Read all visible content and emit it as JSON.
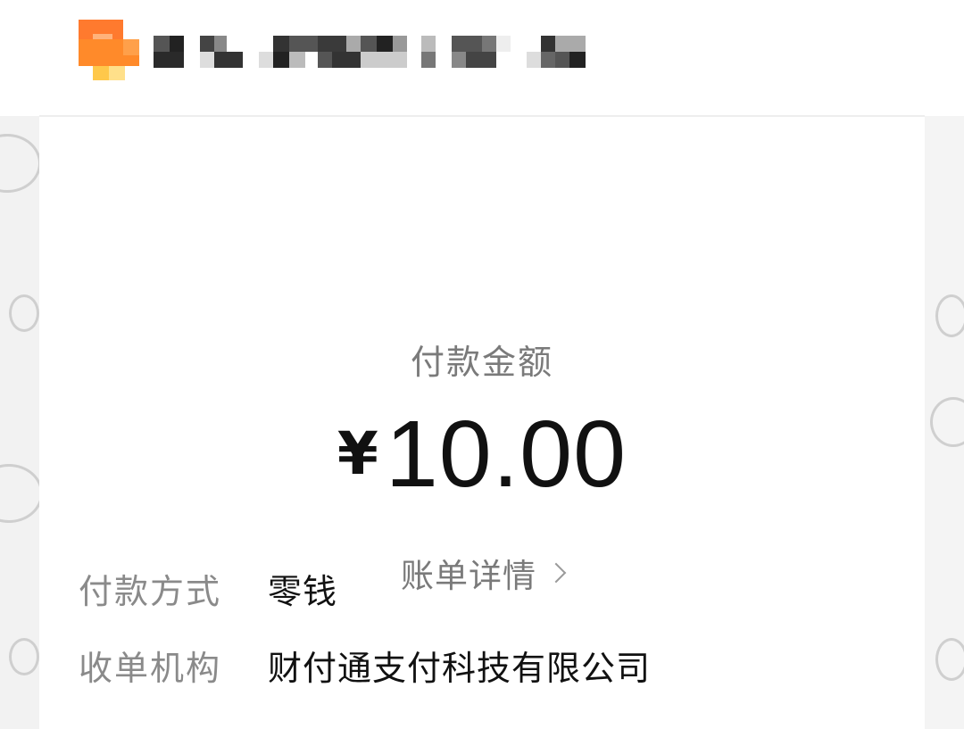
{
  "header": {
    "merchant_name": "",
    "avatar_colors": [
      "#ff7a2e",
      "#ff9b3d",
      "#ffc84a",
      "#ffe08a"
    ]
  },
  "payment": {
    "amount_label": "付款金额",
    "currency_symbol": "¥",
    "amount": "10.00",
    "bill_detail_label": "账单详情"
  },
  "details": [
    {
      "label": "付款方式",
      "value": "零钱"
    },
    {
      "label": "收单机构",
      "value": "财付通支付科技有限公司"
    }
  ],
  "icons": {
    "bill_detail_arrow": "chevron-right-icon"
  }
}
